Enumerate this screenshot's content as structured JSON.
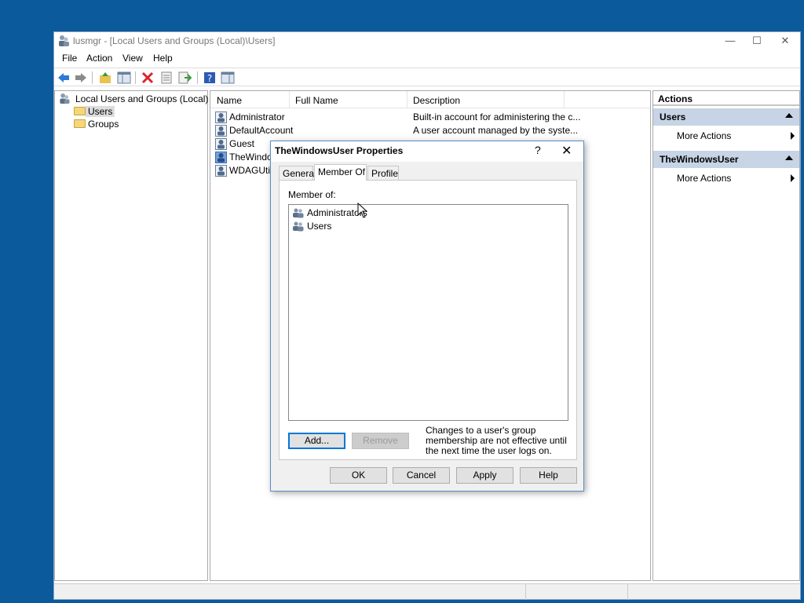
{
  "window": {
    "title": "lusmgr - [Local Users and Groups (Local)\\Users]",
    "minimize_glyph": "—",
    "maximize_glyph": "☐",
    "close_glyph": "✕"
  },
  "menu": [
    "File",
    "Action",
    "View",
    "Help"
  ],
  "toolbar": {
    "icons": [
      "back-arrow-icon",
      "forward-arrow-icon",
      "up-folder-icon",
      "show-hide-tree-icon",
      "delete-icon",
      "properties-icon",
      "export-list-icon",
      "help-icon",
      "show-hide-action-pane-icon"
    ]
  },
  "tree": {
    "root": "Local Users and Groups (Local)",
    "children": [
      "Users",
      "Groups"
    ]
  },
  "list": {
    "columns": [
      "Name",
      "Full Name",
      "Description"
    ],
    "rows": [
      {
        "name": "Administrator",
        "desc": "Built-in account for administering the c..."
      },
      {
        "name": "DefaultAccount",
        "desc": "A user account managed by the syste..."
      },
      {
        "name": "Guest",
        "desc": ""
      },
      {
        "name": "TheWindo",
        "desc": ""
      },
      {
        "name": "WDAGUtili",
        "desc": ""
      }
    ]
  },
  "actions": {
    "title": "Actions",
    "sections": [
      {
        "label": "Users",
        "item": "More Actions"
      },
      {
        "label": "TheWindowsUser",
        "item": "More Actions"
      }
    ]
  },
  "dialog": {
    "title": "TheWindowsUser Properties",
    "help_glyph": "?",
    "close_glyph": "✕",
    "tabs": [
      "General",
      "Member Of",
      "Profile"
    ],
    "active_tab": "Member Of",
    "member_of_label": "Member of:",
    "members": [
      "Administrators",
      "Users"
    ],
    "add_label": "Add...",
    "remove_label": "Remove",
    "note": "Changes to a user's group membership are not effective until the next time the user logs on.",
    "ok_label": "OK",
    "cancel_label": "Cancel",
    "apply_label": "Apply",
    "help_label": "Help"
  },
  "colors": {
    "desktop": "#0a5a9c",
    "action_section": "#c7d4e5",
    "focus_border": "#0078d7"
  }
}
